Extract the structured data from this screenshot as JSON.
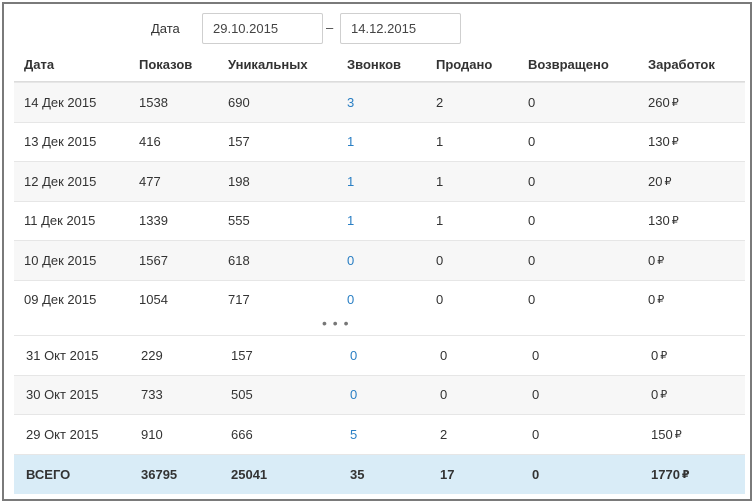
{
  "filter": {
    "label": "Дата",
    "date_from": "29.10.2015",
    "separator": "–",
    "date_to": "14.12.2015"
  },
  "columns": [
    "Дата",
    "Показов",
    "Уникальных",
    "Звонков",
    "Продано",
    "Возвращено",
    "Заработок"
  ],
  "currency_symbol": "₽",
  "rows_top": [
    {
      "date": "14 Дек 2015",
      "views": "1538",
      "unique": "690",
      "calls": "3",
      "sold": "2",
      "returned": "0",
      "earned": "260"
    },
    {
      "date": "13 Дек 2015",
      "views": "416",
      "unique": "157",
      "calls": "1",
      "sold": "1",
      "returned": "0",
      "earned": "130"
    },
    {
      "date": "12 Дек 2015",
      "views": "477",
      "unique": "198",
      "calls": "1",
      "sold": "1",
      "returned": "0",
      "earned": "20"
    },
    {
      "date": "11 Дек 2015",
      "views": "1339",
      "unique": "555",
      "calls": "1",
      "sold": "1",
      "returned": "0",
      "earned": "130"
    },
    {
      "date": "10 Дек 2015",
      "views": "1567",
      "unique": "618",
      "calls": "0",
      "sold": "0",
      "returned": "0",
      "earned": "0"
    },
    {
      "date": "09 Дек 2015",
      "views": "1054",
      "unique": "717",
      "calls": "0",
      "sold": "0",
      "returned": "0",
      "earned": "0"
    }
  ],
  "ellipsis": "• • •",
  "rows_bottom": [
    {
      "date": "31 Окт 2015",
      "views": "229",
      "unique": "157",
      "calls": "0",
      "sold": "0",
      "returned": "0",
      "earned": "0"
    },
    {
      "date": "30 Окт 2015",
      "views": "733",
      "unique": "505",
      "calls": "0",
      "sold": "0",
      "returned": "0",
      "earned": "0"
    },
    {
      "date": "29 Окт 2015",
      "views": "910",
      "unique": "666",
      "calls": "5",
      "sold": "2",
      "returned": "0",
      "earned": "150"
    }
  ],
  "total": {
    "label": "ВСЕГО",
    "views": "36795",
    "unique": "25041",
    "calls": "35",
    "sold": "17",
    "returned": "0",
    "earned": "1770"
  },
  "colors": {
    "link": "#2a7fc4",
    "total_bg": "#d9ecf7",
    "alt_row_bg": "#f7f7f7"
  }
}
